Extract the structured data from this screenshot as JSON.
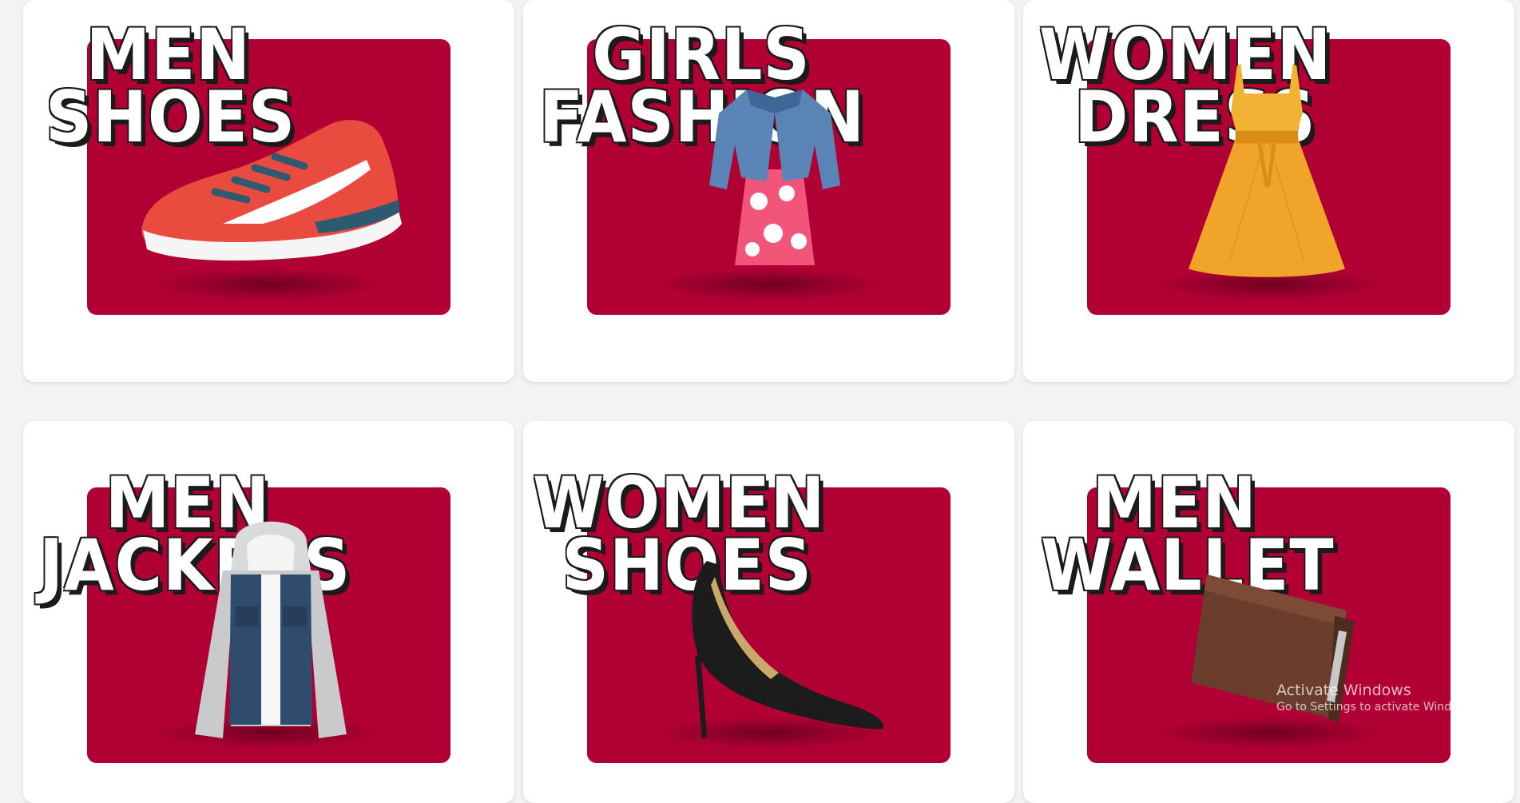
{
  "categories": [
    {
      "line1": "MEN",
      "line2": "SHOES",
      "product_icon": "sneaker-icon"
    },
    {
      "line1": "GIRLS",
      "line2": "FASHION",
      "product_icon": "girls-outfit-icon"
    },
    {
      "line1": "WOMEN",
      "line2": "DRESS",
      "product_icon": "dress-icon"
    },
    {
      "line1": "MEN",
      "line2": "JACKETS",
      "product_icon": "jacket-icon"
    },
    {
      "line1": "WOMEN",
      "line2": "SHOES",
      "product_icon": "high-heel-icon"
    },
    {
      "line1": "MEN",
      "line2": "WALLET",
      "product_icon": "wallet-icon"
    }
  ],
  "colors": {
    "tile": "#b00034",
    "card": "#ffffff",
    "page": "#f3f3f5"
  },
  "watermark": {
    "title": "Activate Windows",
    "subtitle": "Go to Settings to activate Windows."
  }
}
